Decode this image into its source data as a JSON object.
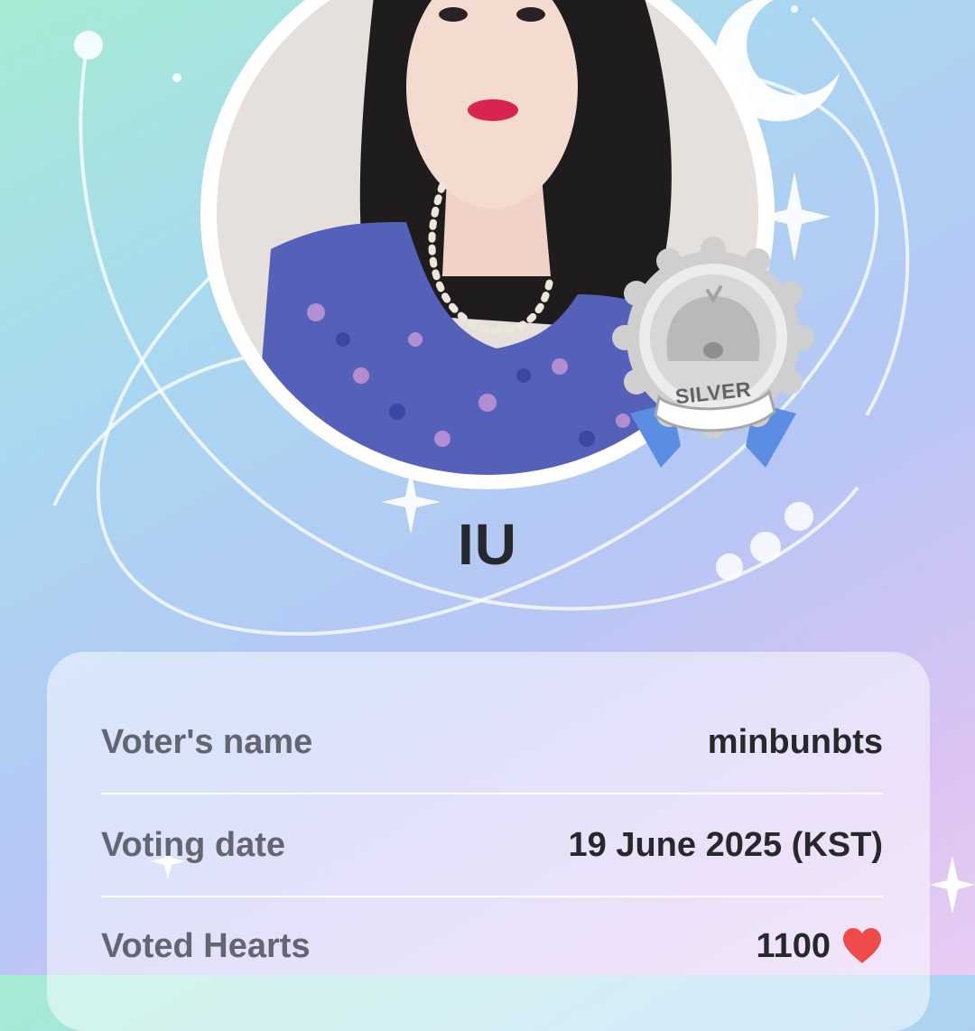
{
  "idol": {
    "name": "IU",
    "rank_badge": "SILVER"
  },
  "vote_details": {
    "rows": [
      {
        "label": "Voter's name",
        "value": "minbunbts"
      },
      {
        "label": "Voting date",
        "value": "19 June 2025 (KST)"
      },
      {
        "label": "Voted Hearts",
        "value": "1100"
      }
    ]
  },
  "icons": {
    "badge": "silver-medal-icon",
    "hearts": "heart-icon",
    "moon": "crescent-moon-icon",
    "sparkle": "sparkle-icon"
  },
  "colors": {
    "heart": "#ef4b4b",
    "badge_silver": "#bcbcbc",
    "ribbon": "#5b8de3"
  }
}
